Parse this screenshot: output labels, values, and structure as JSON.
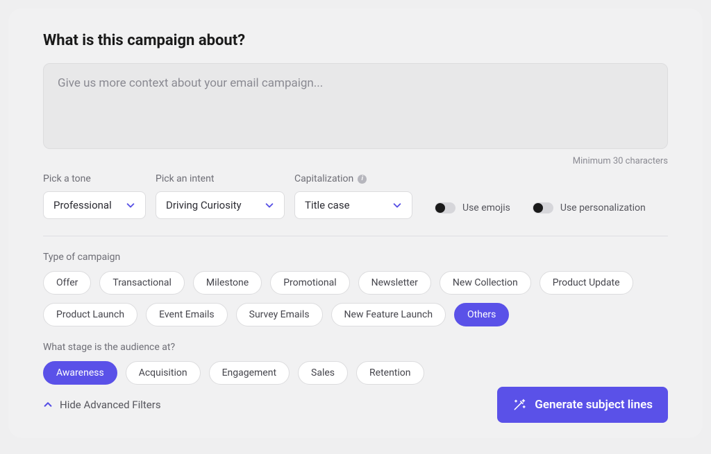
{
  "heading": "What is this campaign about?",
  "textarea": {
    "placeholder": "Give us more context about your email campaign...",
    "value": "",
    "min_chars_label": "Minimum 30 characters"
  },
  "controls": {
    "tone": {
      "label": "Pick a tone",
      "value": "Professional"
    },
    "intent": {
      "label": "Pick an intent",
      "value": "Driving Curiosity"
    },
    "cap": {
      "label": "Capitalization",
      "value": "Title case"
    }
  },
  "toggles": {
    "emojis": {
      "label": "Use emojis",
      "on": false
    },
    "personalization": {
      "label": "Use personalization",
      "on": false
    }
  },
  "campaign_type": {
    "label": "Type of campaign",
    "options": [
      {
        "label": "Offer",
        "active": false
      },
      {
        "label": "Transactional",
        "active": false
      },
      {
        "label": "Milestone",
        "active": false
      },
      {
        "label": "Promotional",
        "active": false
      },
      {
        "label": "Newsletter",
        "active": false
      },
      {
        "label": "New Collection",
        "active": false
      },
      {
        "label": "Product Update",
        "active": false
      },
      {
        "label": "Product Launch",
        "active": false
      },
      {
        "label": "Event Emails",
        "active": false
      },
      {
        "label": "Survey Emails",
        "active": false
      },
      {
        "label": "New Feature Launch",
        "active": false
      },
      {
        "label": "Others",
        "active": true
      }
    ]
  },
  "audience_stage": {
    "label": "What stage is the audience at?",
    "options": [
      {
        "label": "Awareness",
        "active": true
      },
      {
        "label": "Acquisition",
        "active": false
      },
      {
        "label": "Engagement",
        "active": false
      },
      {
        "label": "Sales",
        "active": false
      },
      {
        "label": "Retention",
        "active": false
      }
    ]
  },
  "footer": {
    "advanced_label": "Hide Advanced Filters",
    "generate_label": "Generate subject lines"
  }
}
